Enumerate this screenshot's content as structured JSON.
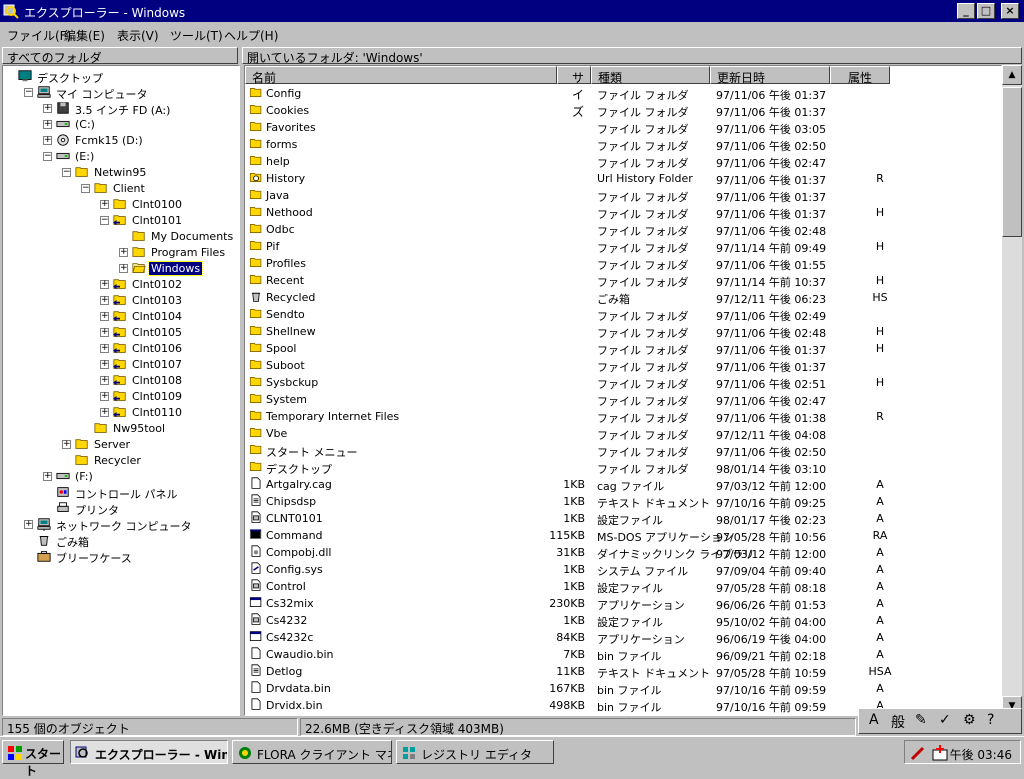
{
  "window": {
    "title": "エクスプローラー - Windows",
    "minimize": "_",
    "maximize": "□",
    "close": "×"
  },
  "menu": [
    "ファイル(F)",
    "編集(E)",
    "表示(V)",
    "ツール(T)",
    "ヘルプ(H)"
  ],
  "left_pane": {
    "header": "すべてのフォルダ"
  },
  "right_pane": {
    "header": "開いているフォルダ: 'Windows'"
  },
  "tree": [
    {
      "label": "デスクトップ",
      "icon": "desktop-icon"
    },
    {
      "label": "マイ コンピュータ",
      "icon": "computer-icon",
      "exp": "−"
    },
    {
      "label": "3.5 インチ FD (A:)",
      "icon": "floppy-icon",
      "exp": "+"
    },
    {
      "label": "(C:)",
      "icon": "drive-icon",
      "exp": "+"
    },
    {
      "label": "Fcmk15 (D:)",
      "icon": "cdrom-icon",
      "exp": "+"
    },
    {
      "label": "(E:)",
      "icon": "drive-icon",
      "exp": "−"
    },
    {
      "label": "Netwin95",
      "icon": "folder-icon",
      "exp": "−"
    },
    {
      "label": "Client",
      "icon": "folder-icon",
      "exp": "−"
    },
    {
      "label": "Clnt0100",
      "icon": "folder-icon",
      "exp": "+"
    },
    {
      "label": "Clnt0101",
      "icon": "shared-folder-icon",
      "exp": "−"
    },
    {
      "label": "My Documents",
      "icon": "folder-icon"
    },
    {
      "label": "Program Files",
      "icon": "folder-icon",
      "exp": "+"
    },
    {
      "label": "Windows",
      "icon": "open-folder-icon",
      "exp": "+"
    },
    {
      "label": "Clnt0102",
      "icon": "shared-folder-icon",
      "exp": "+"
    },
    {
      "label": "Clnt0103",
      "icon": "shared-folder-icon",
      "exp": "+"
    },
    {
      "label": "Clnt0104",
      "icon": "shared-folder-icon",
      "exp": "+"
    },
    {
      "label": "Clnt0105",
      "icon": "shared-folder-icon",
      "exp": "+"
    },
    {
      "label": "Clnt0106",
      "icon": "shared-folder-icon",
      "exp": "+"
    },
    {
      "label": "Clnt0107",
      "icon": "shared-folder-icon",
      "exp": "+"
    },
    {
      "label": "Clnt0108",
      "icon": "shared-folder-icon",
      "exp": "+"
    },
    {
      "label": "Clnt0109",
      "icon": "shared-folder-icon",
      "exp": "+"
    },
    {
      "label": "Clnt0110",
      "icon": "shared-folder-icon",
      "exp": "+"
    },
    {
      "label": "Nw95tool",
      "icon": "folder-icon"
    },
    {
      "label": "Server",
      "icon": "folder-icon",
      "exp": "+"
    },
    {
      "label": "Recycler",
      "icon": "folder-icon"
    },
    {
      "label": "(F:)",
      "icon": "drive-icon",
      "exp": "+"
    },
    {
      "label": "コントロール パネル",
      "icon": "control-panel-icon"
    },
    {
      "label": "プリンタ",
      "icon": "printer-icon"
    },
    {
      "label": "ネットワーク コンピュータ",
      "icon": "network-icon",
      "exp": "+"
    },
    {
      "label": "ごみ箱",
      "icon": "recycle-bin-icon"
    },
    {
      "label": "ブリーフケース",
      "icon": "briefcase-icon"
    }
  ],
  "columns": [
    "名前",
    "サイズ",
    "種類",
    "更新日時",
    "属性"
  ],
  "rows": [
    {
      "name": "Config",
      "size": "",
      "type": "ファイル フォルダ",
      "date": "97/11/06 午後 01:37",
      "attr": "",
      "icon": "folder-icon"
    },
    {
      "name": "Cookies",
      "size": "",
      "type": "ファイル フォルダ",
      "date": "97/11/06 午後 01:37",
      "attr": "",
      "icon": "folder-icon"
    },
    {
      "name": "Favorites",
      "size": "",
      "type": "ファイル フォルダ",
      "date": "97/11/06 午後 03:05",
      "attr": "",
      "icon": "folder-icon"
    },
    {
      "name": "forms",
      "size": "",
      "type": "ファイル フォルダ",
      "date": "97/11/06 午後 02:50",
      "attr": "",
      "icon": "folder-icon"
    },
    {
      "name": "help",
      "size": "",
      "type": "ファイル フォルダ",
      "date": "97/11/06 午後 02:47",
      "attr": "",
      "icon": "folder-icon"
    },
    {
      "name": "History",
      "size": "",
      "type": "Url History Folder",
      "date": "97/11/06 午後 01:37",
      "attr": "R",
      "icon": "history-folder-icon"
    },
    {
      "name": "Java",
      "size": "",
      "type": "ファイル フォルダ",
      "date": "97/11/06 午後 01:37",
      "attr": "",
      "icon": "folder-icon"
    },
    {
      "name": "Nethood",
      "size": "",
      "type": "ファイル フォルダ",
      "date": "97/11/06 午後 01:37",
      "attr": "H",
      "icon": "folder-icon"
    },
    {
      "name": "Odbc",
      "size": "",
      "type": "ファイル フォルダ",
      "date": "97/11/06 午後 02:48",
      "attr": "",
      "icon": "folder-icon"
    },
    {
      "name": "Pif",
      "size": "",
      "type": "ファイル フォルダ",
      "date": "97/11/14 午前 09:49",
      "attr": "H",
      "icon": "folder-icon"
    },
    {
      "name": "Profiles",
      "size": "",
      "type": "ファイル フォルダ",
      "date": "97/11/06 午後 01:55",
      "attr": "",
      "icon": "folder-icon"
    },
    {
      "name": "Recent",
      "size": "",
      "type": "ファイル フォルダ",
      "date": "97/11/14 午前 10:37",
      "attr": "H",
      "icon": "folder-icon"
    },
    {
      "name": "Recycled",
      "size": "",
      "type": "ごみ箱",
      "date": "97/12/11 午後 06:23",
      "attr": "HS",
      "icon": "recycle-bin-icon"
    },
    {
      "name": "Sendto",
      "size": "",
      "type": "ファイル フォルダ",
      "date": "97/11/06 午後 02:49",
      "attr": "",
      "icon": "folder-icon"
    },
    {
      "name": "Shellnew",
      "size": "",
      "type": "ファイル フォルダ",
      "date": "97/11/06 午後 02:48",
      "attr": "H",
      "icon": "folder-icon"
    },
    {
      "name": "Spool",
      "size": "",
      "type": "ファイル フォルダ",
      "date": "97/11/06 午後 01:37",
      "attr": "H",
      "icon": "folder-icon"
    },
    {
      "name": "Suboot",
      "size": "",
      "type": "ファイル フォルダ",
      "date": "97/11/06 午後 01:37",
      "attr": "",
      "icon": "folder-icon"
    },
    {
      "name": "Sysbckup",
      "size": "",
      "type": "ファイル フォルダ",
      "date": "97/11/06 午後 02:51",
      "attr": "H",
      "icon": "folder-icon"
    },
    {
      "name": "System",
      "size": "",
      "type": "ファイル フォルダ",
      "date": "97/11/06 午後 02:47",
      "attr": "",
      "icon": "folder-icon"
    },
    {
      "name": "Temporary Internet Files",
      "size": "",
      "type": "ファイル フォルダ",
      "date": "97/11/06 午後 01:38",
      "attr": "R",
      "icon": "folder-icon"
    },
    {
      "name": "Vbe",
      "size": "",
      "type": "ファイル フォルダ",
      "date": "97/12/11 午後 04:08",
      "attr": "",
      "icon": "folder-icon"
    },
    {
      "name": "スタート メニュー",
      "size": "",
      "type": "ファイル フォルダ",
      "date": "97/11/06 午後 02:50",
      "attr": "",
      "icon": "folder-icon"
    },
    {
      "name": "デスクトップ",
      "size": "",
      "type": "ファイル フォルダ",
      "date": "98/01/14 午後 03:10",
      "attr": "",
      "icon": "folder-icon"
    },
    {
      "name": "Artgalry.cag",
      "size": "1KB",
      "type": "cag ファイル",
      "date": "97/03/12 午前 12:00",
      "attr": "A",
      "icon": "file-icon"
    },
    {
      "name": "Chipsdsp",
      "size": "1KB",
      "type": "テキスト ドキュメント",
      "date": "97/10/16 午前 09:25",
      "attr": "A",
      "icon": "text-file-icon"
    },
    {
      "name": "CLNT0101",
      "size": "1KB",
      "type": "設定ファイル",
      "date": "98/01/17 午後 02:23",
      "attr": "A",
      "icon": "ini-file-icon"
    },
    {
      "name": "Command",
      "size": "115KB",
      "type": "MS-DOS アプリケーション",
      "date": "97/05/28 午前 10:56",
      "attr": "RA",
      "icon": "dos-app-icon"
    },
    {
      "name": "Compobj.dll",
      "size": "31KB",
      "type": "ダイナミックリンク ライブラリ",
      "date": "97/03/12 午前 12:00",
      "attr": "A",
      "icon": "dll-file-icon"
    },
    {
      "name": "Config.sys",
      "size": "1KB",
      "type": "システム ファイル",
      "date": "97/09/04 午前 09:40",
      "attr": "A",
      "icon": "sys-file-icon"
    },
    {
      "name": "Control",
      "size": "1KB",
      "type": "設定ファイル",
      "date": "97/05/28 午前 08:18",
      "attr": "A",
      "icon": "ini-file-icon"
    },
    {
      "name": "Cs32mix",
      "size": "230KB",
      "type": "アプリケーション",
      "date": "96/06/26 午前 01:53",
      "attr": "A",
      "icon": "app-icon"
    },
    {
      "name": "Cs4232",
      "size": "1KB",
      "type": "設定ファイル",
      "date": "95/10/02 午前 04:00",
      "attr": "A",
      "icon": "ini-file-icon"
    },
    {
      "name": "Cs4232c",
      "size": "84KB",
      "type": "アプリケーション",
      "date": "96/06/19 午後 04:00",
      "attr": "A",
      "icon": "app-icon"
    },
    {
      "name": "Cwaudio.bin",
      "size": "7KB",
      "type": "bin ファイル",
      "date": "96/09/21 午前 02:18",
      "attr": "A",
      "icon": "file-icon"
    },
    {
      "name": "Detlog",
      "size": "11KB",
      "type": "テキスト ドキュメント",
      "date": "97/05/28 午前 10:59",
      "attr": "HSA",
      "icon": "text-file-icon"
    },
    {
      "name": "Drvdata.bin",
      "size": "167KB",
      "type": "bin ファイル",
      "date": "97/10/16 午前 09:59",
      "attr": "A",
      "icon": "file-icon"
    },
    {
      "name": "Drvidx.bin",
      "size": "498KB",
      "type": "bin ファイル",
      "date": "97/10/16 午前 09:59",
      "attr": "A",
      "icon": "file-icon"
    }
  ],
  "status": {
    "objects": "155 個のオブジェクト",
    "disk": "22.6MB (空きディスク領域 403MB)"
  },
  "ime": [
    "A",
    "般",
    "✎",
    "✓",
    "⚙",
    "?"
  ],
  "taskbar": {
    "start": "スタート",
    "tasks": [
      {
        "label": "エクスプローラー - Windows",
        "icon": "explorer-icon"
      },
      {
        "label": "FLORA クライアント マネージ...",
        "icon": "flora-icon"
      },
      {
        "label": "レジストリ エディタ",
        "icon": "regedit-icon"
      }
    ],
    "clock": "午後 03:46"
  },
  "colors": {
    "title_bg": "#000080",
    "face": "#c0c0c0",
    "folder": "#ffd700"
  }
}
